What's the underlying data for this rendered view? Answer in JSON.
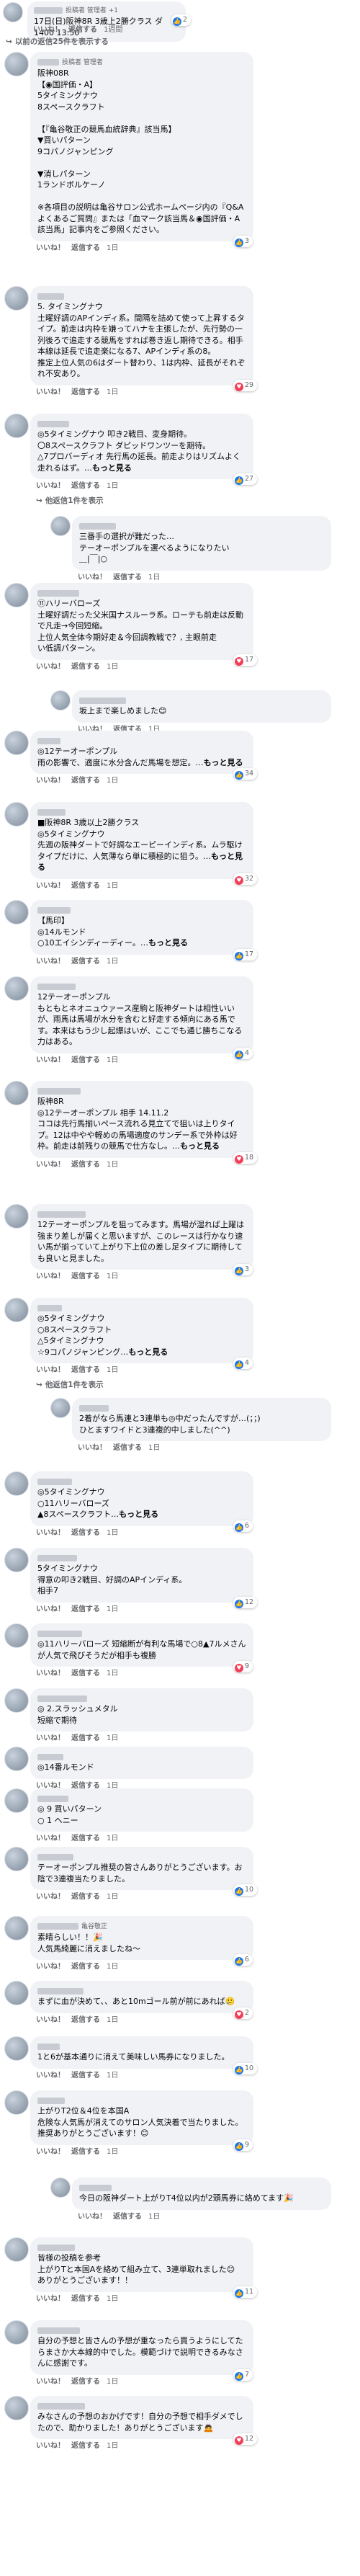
{
  "top": {
    "header_badge": "投稿者 管理者 +1",
    "date_line": "17日(日)阪神8R 3歳上2勝クラス ダ1400 13:50",
    "count": "2",
    "actions": [
      "いいね！",
      "返信する",
      "1週間"
    ],
    "prev_replies": "以前の返信25件を表示する"
  },
  "comments": [
    {
      "badge": "投稿者 管理者",
      "text": "阪神08R\n【◉国評価・A】\n5タイミングナウ\n8スペースクラフト\n\n【『亀谷敬正の競馬血統辞典』該当馬】\n▼買いパターン\n9コパノジャンピング\n\n▼消しパターン\n1ランドボルケーノ\n\n※各項目の説明は亀谷サロン公式ホームページ内の『Q&A よくあるご質問』または「血マーク該当馬＆◉国評価・A該当馬」記事内をご参照ください。",
      "time": "1日",
      "react": "3"
    },
    {
      "text": "5. タイミングナウ\n土曜好調のAPインディ系。間隔を詰めて使って上昇するタイプ。前走は内枠を嫌ってハナを主張したが、先行勢の一列後ろで追走する競馬をすれば巻き返し期待できる。相手本線は延長で追走楽になる7、APインディ系の8。\n推定上位人気の6はダート替わり、1は内枠、延長がそれぞれ不安あり。",
      "time": "1日",
      "react": "29"
    },
    {
      "text": "◎5タイミングナウ 叩き2戦目、変身期待。\n〇8スペースクラフト ダピッドワンツーを期待。\n△7プロバーディオ 先行馬の延長。前走よりはリズムよく走れるはず。…",
      "more": "もっと見る",
      "time": "1日",
      "react": "27",
      "replies_link": "他返信1件を表示"
    },
    {
      "reply": true,
      "text": "三番手の選択が難だった…\nテーオーポンプルを選べるようになりたい\n＿|￣|○",
      "time": "1日"
    },
    {
      "text": "⑪ハリーバローズ\n土曜好調だった父米国ナスルーラ系。ローテも前走は反動で凡走→今回短縮。\n上位人気全体今期好走＆今回調教戦で？, 主眼前走\nい低調パターン。",
      "time": "1日",
      "react": "17"
    },
    {
      "reply": true,
      "text": "坂上まで楽しめました😊",
      "time": "1日"
    },
    {
      "text": "◎12テーオーポンプル\n雨の影響で、適度に水分含んだ馬場を想定。…",
      "more": "もっと見る",
      "time": "1日",
      "react": "34"
    },
    {
      "text": "■阪神8R 3歳以上2勝クラス\n◎5タイミングナウ\n先週の阪神ダートで好調なエーピーインディ系。ムラ駆けタイプだけに、人気薄なら単に積極的に狙う。…",
      "more": "もっと見る",
      "time": "1日",
      "react": "32"
    },
    {
      "text": "【馬印】\n◎14ルモンド\n○10エイシンディーディー。…",
      "more": "もっと見る",
      "time": "1日",
      "react": "17"
    },
    {
      "text": "12テーオーポンプル\nもともとネオニュウァース産駒と阪神ダートは相性いいが、雨馬は馬場が水分を含むと好走する傾向にある馬です。本来はもう少し起爆はいが、ここでも通じ勝ちこなる力はある。",
      "time": "1日",
      "react": "4"
    },
    {
      "text": "阪神8R\n◎12テーオーポンプル 相手 14.11.2\nココは先行馬揃いペース流れる見立てで狙いは上りタイプ。12は中やや軽めの馬場適度のサンデー系で外枠は好枠。前走は前残りの競馬で仕方なし。…",
      "more": "もっと見る",
      "time": "1日",
      "react": "18"
    },
    {
      "text": "12テーオーポンプルを狙ってみます。馬場が湿れば上躍は強まり差しが届くと思いますが、このレースは行かなり速い馬が揃っていて上がり下上位の差し足タイプに期待しても良いと見ました。",
      "time": "1日",
      "react": "3"
    },
    {
      "text": "◎5タイミングナウ\n○8スペースクラフト\n△5タイミングナウ\n☆9コパノジャンピング…",
      "more": "もっと見る",
      "time": "1日",
      "react": "4",
      "replies_link": "他返信1件を表示"
    },
    {
      "reply": true,
      "text": "2着がなら馬連と3連単も◎中だったんですが…(；；)\nひとますワイドと3連複的中しました(^^)",
      "time": "1日"
    },
    {
      "text": "◎5タイミングナウ\n○11ハリーバローズ\n▲8スペースクラフト…",
      "more": "もっと見る",
      "time": "1日",
      "react": "6"
    },
    {
      "text": "5タイミングナウ\n得意の叩き2戦目、好調のAPインディ系。\n相手7",
      "time": "1日",
      "react": "12"
    },
    {
      "text": "◎11ハリーバローズ 短縮断が有利な馬場で○8▲7ルメさんが人気で飛びそうだが相手も複勝",
      "time": "1日",
      "react": "9"
    },
    {
      "text": "◎ 2.スラッシュメタル\n短縮で期待",
      "time": "1日"
    },
    {
      "text": "◎14番ルモンド",
      "time": "1日"
    },
    {
      "text": "◎ 9 買いパターン\n○ 1 ヘニー",
      "time": "1日"
    },
    {
      "text": "テーオーポンプル推奨の皆さんありがとうございます。お陰で3連複当たりました。",
      "time": "1日",
      "react": "10"
    },
    {
      "badge": "亀谷敬正",
      "text": "素晴らしい！！🎉\n人気馬綺麗に消えましたね～",
      "time": "1日",
      "react": "6"
    },
    {
      "text": "まずに血が決めて、、あと10mゴール前が前にあれば🥲",
      "time": "1日",
      "react": "2"
    },
    {
      "text": "1と6が基本通りに消えて美味しい馬券になりました。",
      "time": "1日",
      "react": "10"
    },
    {
      "text": "上がりT2位＆4位を本国A\n危険な人気馬が消えてのサロン人気決着で当たりました。推奨ありがとうございます！😊",
      "time": "1日",
      "react": "9"
    },
    {
      "reply": true,
      "text": "今日の阪神ダート上がりT4位以内が2頭馬券に絡めてます🎉",
      "time": "1日"
    },
    {
      "text": "皆様の投稿を参考\n上がりTと本国Aを絡めて組み立て、3連単取れました😊\nありがとうございます！！",
      "time": "1日",
      "react": "11"
    },
    {
      "text": "自分の予想と皆さんの予想が重なったら買うようにしてたらまさか大本線的中でした。模範づけで説明できるみなさんに感謝です。",
      "time": "1日",
      "react": "7"
    },
    {
      "text": "みなさんの予想のおかげです！自分の予想で相手ダメでしたので、助かりました！ありがとうございます🙇",
      "time": "1日",
      "react": "12"
    }
  ],
  "labels": {
    "like": "いいね！",
    "reply": "返信する",
    "more": "もっと見る"
  }
}
